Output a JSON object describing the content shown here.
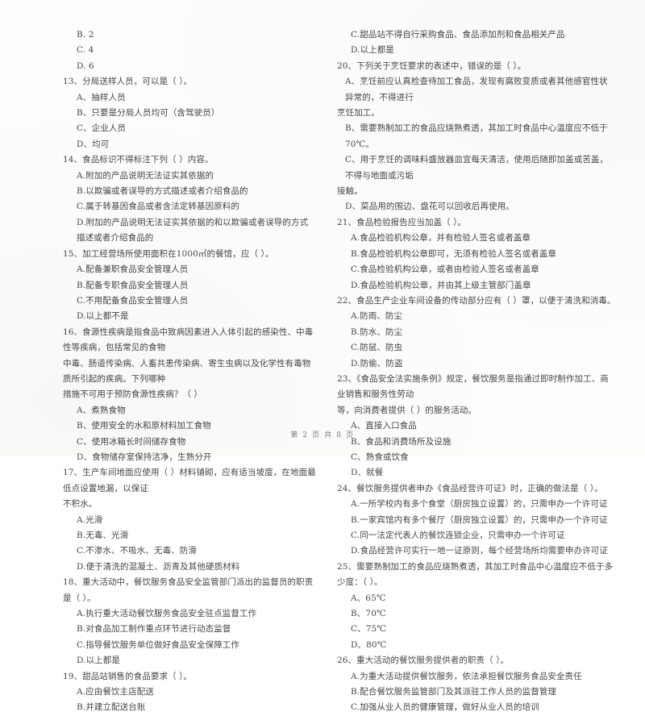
{
  "document": {
    "type": "exam-paper",
    "language": "zh-CN",
    "footer": "第 2 页 共 8 页"
  },
  "left_column": [
    {
      "kind": "option",
      "text": "B. 2"
    },
    {
      "kind": "option",
      "text": "C. 4"
    },
    {
      "kind": "option",
      "text": "D. 6"
    },
    {
      "kind": "stem",
      "text": "13、分局送样人员，可以是（      ）。"
    },
    {
      "kind": "option",
      "text": "A、抽样人员"
    },
    {
      "kind": "option",
      "text": "B、只要是分局人员均可（含驾驶员）"
    },
    {
      "kind": "option",
      "text": "C、企业人员"
    },
    {
      "kind": "option",
      "text": "D、均可"
    },
    {
      "kind": "stem",
      "text": "14、食品标识不得标注下列（      ）内容。"
    },
    {
      "kind": "option",
      "text": "A.附加的产品说明无法证实其依据的"
    },
    {
      "kind": "option",
      "text": "B.以欺骗或者误导的方式描述或者介绍食品的"
    },
    {
      "kind": "option",
      "text": "C.属于转基因食品或者含法定转基因原料的"
    },
    {
      "kind": "option",
      "text": "D.附加的产品说明无法证实其依据的和以欺骗或者误导的方式描述或者介绍食品的"
    },
    {
      "kind": "stem",
      "text": "15、加工经营场所使用面积在1000㎡的餐馆，应（      ）。"
    },
    {
      "kind": "option",
      "text": "A.配备兼职食品安全管理人员"
    },
    {
      "kind": "option",
      "text": "B.配备专职食品安全管理人员"
    },
    {
      "kind": "option",
      "text": "C.不用配备食品安全管理人员"
    },
    {
      "kind": "option",
      "text": "D.以上都不是"
    },
    {
      "kind": "stem",
      "text": "16、食源性疾病是指食品中致病因素进入人体引起的感染性、中毒性等疾病，包括常见的食物"
    },
    {
      "kind": "cont",
      "text": "中毒、肠道传染病、人畜共患传染病、寄生虫病以及化学性有毒物质所引起的疾病。下列哪种"
    },
    {
      "kind": "cont",
      "text": "措施不可用于预防食源性疾病？（      ）"
    },
    {
      "kind": "option",
      "text": "A、煮熟食物"
    },
    {
      "kind": "option",
      "text": "B、使用安全的水和原材料加工食物"
    },
    {
      "kind": "option",
      "text": "C、使用冰箱长时间储存食物"
    },
    {
      "kind": "option",
      "text": "D、食物储存室保持洁净，生熟分开"
    },
    {
      "kind": "stem",
      "text": "17、生产车间地面应使用（      ）材料铺砌，应有适当坡度，在地面最低点设置地漏，以保证"
    },
    {
      "kind": "cont",
      "text": "不积水。"
    },
    {
      "kind": "option",
      "text": "A.光滑"
    },
    {
      "kind": "option",
      "text": "B.无毒、光滑"
    },
    {
      "kind": "option",
      "text": "C.不渗水、不吸水、无毒、防滑"
    },
    {
      "kind": "option",
      "text": "D.便于清洗的混凝土、沥青及其他硬质材料"
    },
    {
      "kind": "stem",
      "text": "18、重大活动中，餐饮服务食品安全监管部门派出的监督员的职责是（      ）。"
    },
    {
      "kind": "option",
      "text": "A.执行重大活动餐饮服务食品安全驻点监督工作"
    },
    {
      "kind": "option",
      "text": "B.对食品加工制作重点环节进行动态监督"
    },
    {
      "kind": "option",
      "text": "C.指导餐饮服务单位做好食品安全保障工作"
    },
    {
      "kind": "option",
      "text": "D.以上都是"
    },
    {
      "kind": "stem",
      "text": "19、甜品站销售的食品要求（      ）。"
    },
    {
      "kind": "option",
      "text": "A.应由餐饮主店配送"
    },
    {
      "kind": "option",
      "text": "B.并建立配送台账"
    }
  ],
  "right_column": [
    {
      "kind": "option",
      "text": "C.甜品站不得自行采购食品、食品添加剂和食品相关产品"
    },
    {
      "kind": "option",
      "text": "D.以上都是"
    },
    {
      "kind": "stem",
      "text": "20、下列关于烹饪要求的表述中，错误的是（      ）。"
    },
    {
      "kind": "sub",
      "text": "A、烹饪前应认真检查待加工食品，发现有腐败变质或者其他感官性状异常的，不得进行"
    },
    {
      "kind": "cont",
      "text": "烹饪加工。"
    },
    {
      "kind": "sub",
      "text": "B、需要熟制加工的食品应烧熟煮透，其加工时食品中心温度应不低于70℃。"
    },
    {
      "kind": "sub",
      "text": "C、用于烹饪的调味料盛放器皿宜每天清洁，使用后随即加盖或苦盖，不得与地面或污垢"
    },
    {
      "kind": "cont",
      "text": "接触。"
    },
    {
      "kind": "sub",
      "text": "D、菜品用的围边、盘花可以回收后再使用。"
    },
    {
      "kind": "stem",
      "text": "21、食品检验报告应当加盖（      ）。"
    },
    {
      "kind": "option",
      "text": "A.食品检验机构公章，并有检验人签名或者盖章"
    },
    {
      "kind": "option",
      "text": "B.食品检验机构公章即可，无须有检验人签名或者盖章"
    },
    {
      "kind": "option",
      "text": "C.食品检验机构公章，或者由检验人签名或者盖章"
    },
    {
      "kind": "option",
      "text": "D.食品检验机构公章，并由其上级主管部门盖章"
    },
    {
      "kind": "stem",
      "text": "22、食品生产企业车间设备的传动部分应有（      ）罩，以便于清洗和消毒。"
    },
    {
      "kind": "option",
      "text": "A.防雨、防尘"
    },
    {
      "kind": "option",
      "text": "B.防水、防尘"
    },
    {
      "kind": "option",
      "text": "C.防鼠、防虫"
    },
    {
      "kind": "option",
      "text": "D.防偷、防盗"
    },
    {
      "kind": "stem",
      "text": "23、《食品安全法实施条例》规定，餐饮服务是指通过即时制作加工、商业销售和服务性劳动"
    },
    {
      "kind": "cont",
      "text": "等，向消费者提供（      ）的服务活动。"
    },
    {
      "kind": "option",
      "text": "A、直接入口食品"
    },
    {
      "kind": "option",
      "text": "B、食品和消费场所及设施"
    },
    {
      "kind": "option",
      "text": "C、熟食或饮食"
    },
    {
      "kind": "option",
      "text": "D、就餐"
    },
    {
      "kind": "stem",
      "text": "24、餐饮服务提供者申办《食品经营许可证》时，正确的做法是（      ）。"
    },
    {
      "kind": "option",
      "text": "A.一所学校内有多个食堂（厨房独立设置）的，只需申办一个许可证"
    },
    {
      "kind": "option",
      "text": "B.一家宾馆内有多个餐厅（厨房独立设置）的，只需申办一个许可证"
    },
    {
      "kind": "option",
      "text": "C.同一法定代表人的餐饮连锁企业，只需申办一个许可证"
    },
    {
      "kind": "option",
      "text": "D.食品经营许可实行一地一证原则，每个经营场所均需要申办许可证"
    },
    {
      "kind": "stem",
      "text": "25、需要熟制加工的食品应烧熟煮透，其加工时食品中心温度应不低于多少度：（      ）。"
    },
    {
      "kind": "option",
      "text": "A、65℃"
    },
    {
      "kind": "option",
      "text": "B、70℃"
    },
    {
      "kind": "option",
      "text": "C、75℃"
    },
    {
      "kind": "option",
      "text": "D、80℃"
    },
    {
      "kind": "stem",
      "text": "26、重大活动的餐饮服务提供者的职责（      ）。"
    },
    {
      "kind": "option",
      "text": "A.为重大活动提供餐饮服务，依法承担餐饮服务食品安全责任"
    },
    {
      "kind": "option",
      "text": "B.配合餐饮服务监管部门及其派驻工作人员的监督管理"
    },
    {
      "kind": "option",
      "text": "C.加强从业人员的健康管理，做好从业人员的培训"
    }
  ]
}
